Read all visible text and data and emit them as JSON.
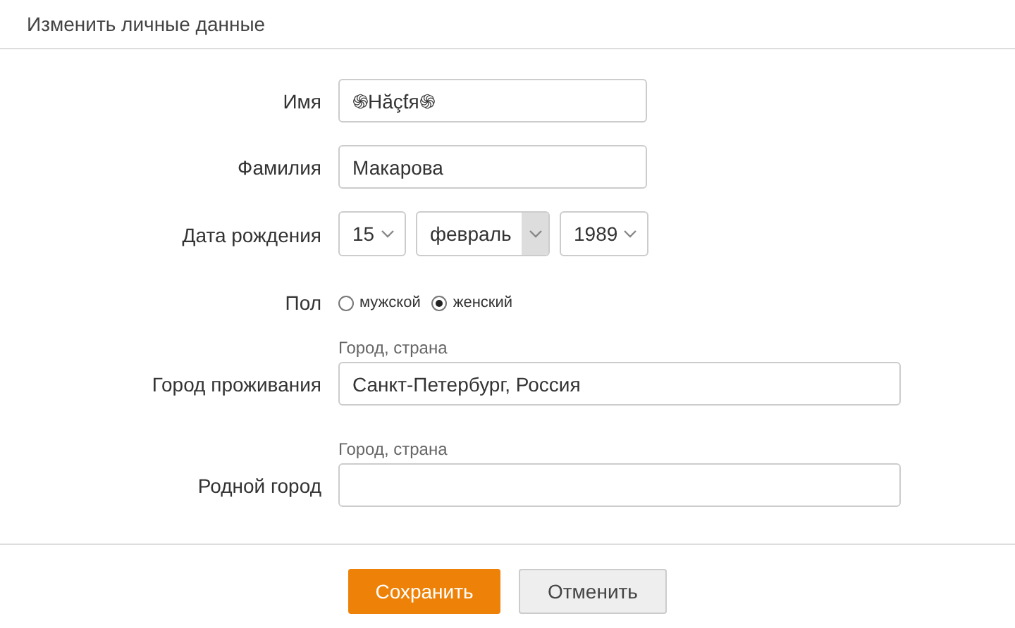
{
  "title": "Изменить личные данные",
  "fields": [
    {
      "kind": "text",
      "label": "Имя",
      "value": "֍Hăçƭя֍",
      "wide": false
    },
    {
      "kind": "text",
      "label": "Фамилия",
      "value": "Макарова",
      "wide": false
    },
    {
      "kind": "date",
      "label": "Дата рождения",
      "day": "15",
      "month": "февраль",
      "year": "1989"
    },
    {
      "kind": "radio",
      "label": "Пол",
      "options": [
        {
          "label": "мужской",
          "selected": false
        },
        {
          "label": "женский",
          "selected": true
        }
      ]
    },
    {
      "kind": "text",
      "label": "Город проживания",
      "hint": "Город, страна",
      "value": "Санкт-Петербург, Россия",
      "wide": true
    },
    {
      "kind": "text",
      "label": "Родной город",
      "hint": "Город, страна",
      "wide": true
    }
  ],
  "buttons": [
    {
      "label": "Сохранить",
      "primary": true
    },
    {
      "label": "Отменить",
      "primary": false
    }
  ]
}
